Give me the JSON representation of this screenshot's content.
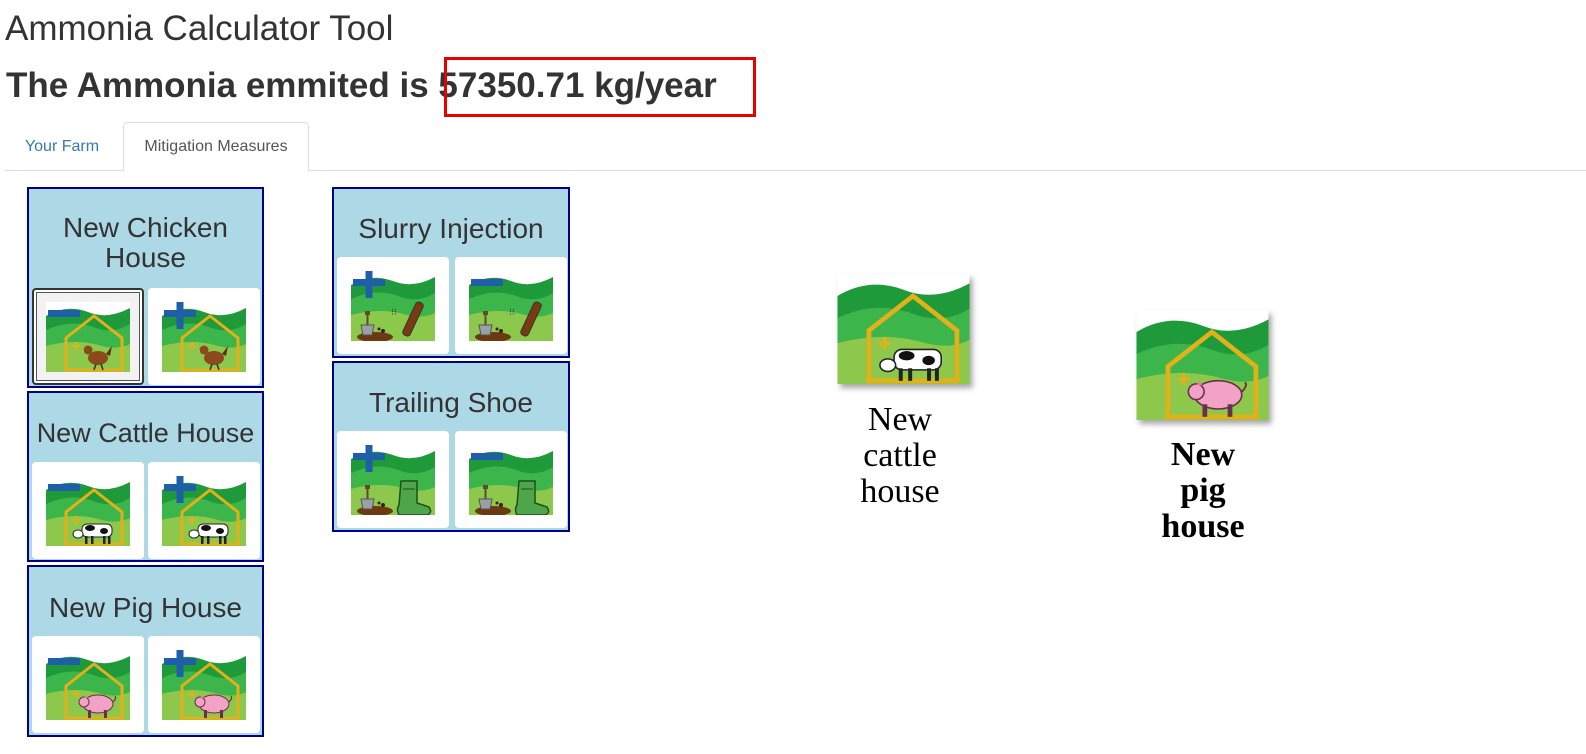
{
  "app": {
    "title": "Ammonia Calculator Tool"
  },
  "result": {
    "prefix": "The Ammonia emmited is ",
    "value": "57350.71 kg/year"
  },
  "tabs": [
    {
      "label": "Your Farm",
      "active": false
    },
    {
      "label": "Mitigation Measures",
      "active": true
    }
  ],
  "panels": {
    "chicken": {
      "title_line1": "New Chicken",
      "title_line2": "House"
    },
    "cattle": {
      "title": "New Cattle House"
    },
    "pig": {
      "title": "New Pig House"
    },
    "slurry": {
      "title": "Slurry Injection"
    },
    "trailing": {
      "title": "Trailing Shoe"
    }
  },
  "placed": {
    "cattle": {
      "line1": "New",
      "line2": "cattle",
      "line3": "house"
    },
    "pig": {
      "line1": "New",
      "line2": "pig",
      "line3": "house"
    }
  },
  "colors": {
    "panel_bg": "#add8e6",
    "panel_border": "#000080",
    "highlight": "#e60000",
    "link": "#337ab7"
  },
  "icons": [
    "minus-icon",
    "plus-icon",
    "chicken-house-icon",
    "cattle-house-icon",
    "pig-house-icon",
    "slurry-injector-icon",
    "trailing-shoe-icon"
  ]
}
